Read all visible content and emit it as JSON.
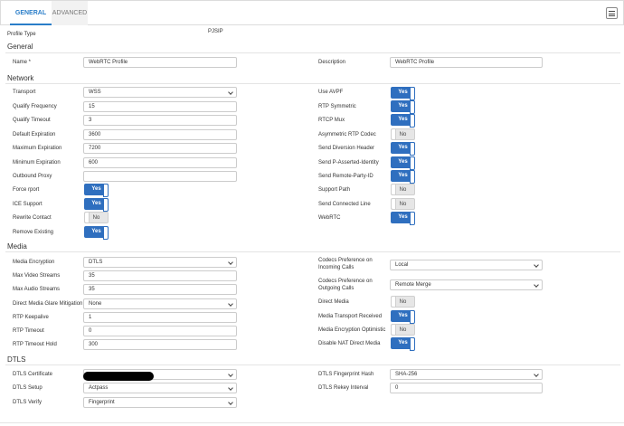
{
  "tabs": {
    "general": "GENERAL",
    "advanced": "ADVANCED"
  },
  "icons": {
    "menu": "list-icon",
    "chevron": "chevron-down-icon"
  },
  "colors": {
    "accent": "#2a7ec9",
    "toggle_on": "#2f6fbf"
  },
  "profile_type": {
    "label": "Profile Type",
    "value": "PJSIP"
  },
  "sections": {
    "general": "General",
    "network": "Network",
    "media": "Media",
    "dtls": "DTLS"
  },
  "general": {
    "name": {
      "label": "Name *",
      "value": "WebRTC Profile"
    },
    "description": {
      "label": "Description",
      "value": "WebRTC Profile"
    }
  },
  "network": {
    "transport": {
      "label": "Transport",
      "value": "WSS"
    },
    "qualify_frequency": {
      "label": "Qualify Frequency",
      "value": "15"
    },
    "qualify_timeout": {
      "label": "Qualify Timeout",
      "value": "3"
    },
    "default_expiration": {
      "label": "Default Expiration",
      "value": "3600"
    },
    "maximum_expiration": {
      "label": "Maximum Expiration",
      "value": "7200"
    },
    "minimum_expiration": {
      "label": "Minimum Expiration",
      "value": "600"
    },
    "outbound_proxy": {
      "label": "Outbound Proxy",
      "value": ""
    },
    "force_rport": {
      "label": "Force rport",
      "value": "Yes"
    },
    "ice_support": {
      "label": "ICE Support",
      "value": "Yes"
    },
    "rewrite_contact": {
      "label": "Rewrite Contact",
      "value": "No"
    },
    "remove_existing": {
      "label": "Remove Existing",
      "value": "Yes"
    },
    "use_avpf": {
      "label": "Use AVPF",
      "value": "Yes"
    },
    "rtp_symmetric": {
      "label": "RTP Symmetric",
      "value": "Yes"
    },
    "rtcp_mux": {
      "label": "RTCP Mux",
      "value": "Yes"
    },
    "asymmetric_rtp_codec": {
      "label": "Asymmetric RTP Codec",
      "value": "No"
    },
    "send_diversion_header": {
      "label": "Send Diversion Header",
      "value": "Yes"
    },
    "send_p_asserted_identity": {
      "label": "Send P-Asserted-Identity",
      "value": "Yes"
    },
    "send_remote_party_id": {
      "label": "Send Remote-Party-ID",
      "value": "Yes"
    },
    "support_path": {
      "label": "Support Path",
      "value": "No"
    },
    "send_connected_line": {
      "label": "Send Connected Line",
      "value": "No"
    },
    "webrtc": {
      "label": "WebRTC",
      "value": "Yes"
    }
  },
  "media": {
    "media_encryption": {
      "label": "Media Encryption",
      "value": "DTLS"
    },
    "max_video_streams": {
      "label": "Max Video Streams",
      "value": "35"
    },
    "max_audio_streams": {
      "label": "Max Audio Streams",
      "value": "35"
    },
    "direct_media_glare": {
      "label": "Direct Media Glare Mitigation",
      "value": "None"
    },
    "rtp_keepalive": {
      "label": "RTP Keepalive",
      "value": "1"
    },
    "rtp_timeout": {
      "label": "RTP Timeout",
      "value": "0"
    },
    "rtp_timeout_hold": {
      "label": "RTP Timeout Hold",
      "value": "300"
    },
    "codecs_incoming": {
      "label1": "Codecs Preference on",
      "label2": "Incoming Calls",
      "value": "Local"
    },
    "codecs_outgoing": {
      "label1": "Codecs Preference on",
      "label2": "Outgoing Calls",
      "value": "Remote Merge"
    },
    "direct_media": {
      "label": "Direct Media",
      "value": "No"
    },
    "media_transport_received": {
      "label": "Media Transport Received",
      "value": "Yes"
    },
    "media_encryption_optimistic": {
      "label": "Media Encryption Optimistic",
      "value": "No"
    },
    "disable_nat_direct_media": {
      "label": "Disable NAT Direct Media",
      "value": "Yes"
    }
  },
  "dtls": {
    "certificate": {
      "label": "DTLS Certificate",
      "value": ""
    },
    "setup": {
      "label": "DTLS Setup",
      "value": "Actpass"
    },
    "verify": {
      "label": "DTLS Verify",
      "value": "Fingerprint"
    },
    "fingerprint_hash": {
      "label": "DTLS Fingerprint Hash",
      "value": "SHA-256"
    },
    "rekey_interval": {
      "label": "DTLS Rekey Interval",
      "value": "0"
    }
  }
}
